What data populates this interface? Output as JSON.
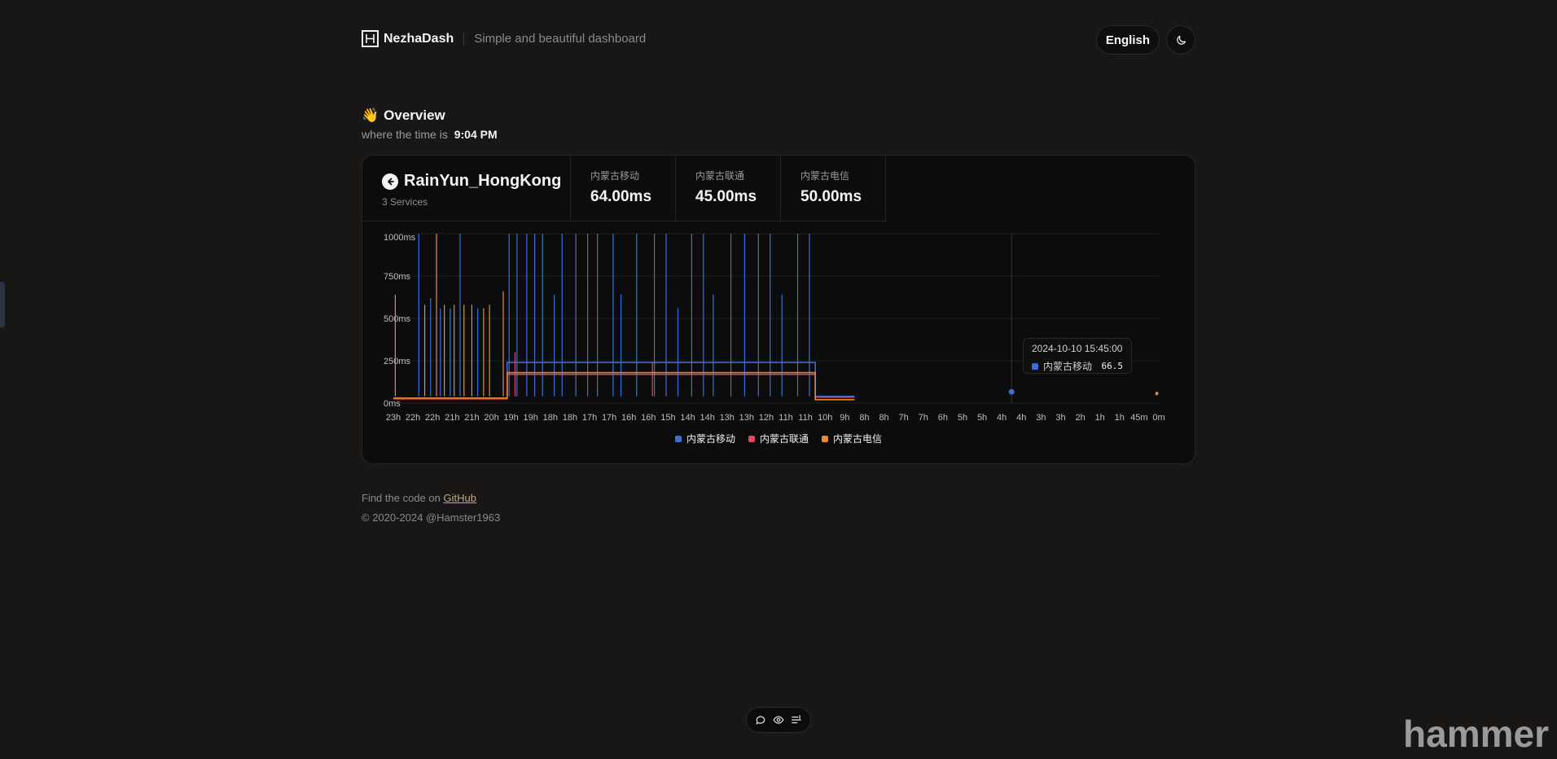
{
  "header": {
    "brand": "NezhaDash",
    "tagline": "Simple and beautiful dashboard",
    "language_label": "English",
    "theme_icon": "moon-icon"
  },
  "overview": {
    "emoji": "👋",
    "title": "Overview",
    "time_prefix": "where the time is",
    "time": "9:04 PM"
  },
  "server": {
    "name": "RainYun_HongKong",
    "services_count": "3 Services",
    "back_icon": "arrow-left-circle-icon"
  },
  "stats": [
    {
      "label": "内蒙古移动",
      "value": "64.00ms"
    },
    {
      "label": "内蒙古联通",
      "value": "45.00ms"
    },
    {
      "label": "内蒙古电信",
      "value": "50.00ms"
    }
  ],
  "colors": {
    "mobile": "#3b6fd6",
    "unicom": "#e0485c",
    "telecom": "#e98a34"
  },
  "tooltip": {
    "time": "2024-10-10 15:45:00",
    "series": "内蒙古移动",
    "value": "66.5"
  },
  "chart_data": {
    "type": "line",
    "y_ticks": [
      "0ms",
      "250ms",
      "500ms",
      "750ms",
      "1000ms"
    ],
    "ylim": [
      0,
      1000
    ],
    "x_ticks": [
      "23h",
      "22h",
      "22h",
      "21h",
      "21h",
      "20h",
      "19h",
      "19h",
      "18h",
      "18h",
      "17h",
      "17h",
      "16h",
      "16h",
      "15h",
      "14h",
      "14h",
      "13h",
      "13h",
      "12h",
      "11h",
      "11h",
      "10h",
      "9h",
      "8h",
      "8h",
      "7h",
      "7h",
      "6h",
      "5h",
      "5h",
      "4h",
      "4h",
      "3h",
      "3h",
      "2h",
      "1h",
      "1h",
      "45m",
      "0m"
    ],
    "legend_position": "bottom",
    "series": [
      {
        "name": "内蒙古移动",
        "color": "#3b6fd6",
        "baseline": [
          [
            0,
            30
          ],
          [
            5.8,
            30
          ],
          [
            5.8,
            240
          ],
          [
            21.5,
            240
          ],
          [
            21.5,
            40
          ],
          [
            23.5,
            40
          ]
        ],
        "spikes": [
          [
            1.3,
            1000
          ],
          [
            1.9,
            620
          ],
          [
            2.4,
            560
          ],
          [
            2.9,
            560
          ],
          [
            3.4,
            1000
          ],
          [
            4.3,
            560
          ],
          [
            5.9,
            1000
          ],
          [
            6.3,
            1000
          ],
          [
            6.8,
            1000
          ],
          [
            7.2,
            1000
          ],
          [
            7.6,
            1000
          ],
          [
            8.2,
            640
          ],
          [
            8.6,
            1000
          ],
          [
            9.3,
            1000
          ],
          [
            9.9,
            1000
          ],
          [
            10.4,
            1000
          ],
          [
            11.2,
            1000
          ],
          [
            11.6,
            640
          ],
          [
            12.4,
            1000
          ],
          [
            13.3,
            1000
          ],
          [
            13.9,
            1000
          ],
          [
            14.5,
            560
          ],
          [
            15.2,
            1000
          ],
          [
            15.8,
            1000
          ],
          [
            16.3,
            640
          ],
          [
            17.2,
            1000
          ],
          [
            17.9,
            1000
          ],
          [
            18.6,
            1000
          ],
          [
            19.2,
            1000
          ],
          [
            19.8,
            640
          ],
          [
            20.6,
            1000
          ],
          [
            21.2,
            1000
          ]
        ],
        "points": [
          [
            31.5,
            66.5
          ]
        ]
      },
      {
        "name": "内蒙古联通",
        "color": "#e0485c",
        "baseline": [
          [
            0,
            25
          ],
          [
            5.8,
            25
          ],
          [
            5.8,
            170
          ],
          [
            21.5,
            170
          ],
          [
            21.5,
            35
          ],
          [
            23.5,
            35
          ]
        ],
        "spikes": [
          [
            6.2,
            300
          ],
          [
            13.2,
            240
          ]
        ],
        "points": [
          [
            38.9,
            60
          ]
        ]
      },
      {
        "name": "内蒙古电信",
        "color": "#e98a34",
        "baseline": [
          [
            0,
            30
          ],
          [
            5.8,
            30
          ],
          [
            5.8,
            180
          ],
          [
            21.5,
            180
          ],
          [
            21.5,
            20
          ],
          [
            23.5,
            20
          ]
        ],
        "spikes": [
          [
            0.1,
            640
          ],
          [
            1.6,
            580
          ],
          [
            2.6,
            580
          ],
          [
            3.1,
            580
          ],
          [
            3.6,
            580
          ],
          [
            4.0,
            580
          ],
          [
            4.9,
            580
          ],
          [
            5.6,
            660
          ],
          [
            2.2,
            1000
          ],
          [
            4.6,
            560
          ]
        ],
        "points": [
          [
            38.9,
            55
          ]
        ]
      }
    ]
  },
  "legend": [
    "内蒙古移动",
    "内蒙古联通",
    "内蒙古电信"
  ],
  "footer": {
    "line1_prefix": "Find the code on",
    "line1_link": "GitHub",
    "line2": "© 2020-2024  @Hamster1963"
  },
  "dock": {
    "icons": [
      "message-icon",
      "eye-icon",
      "filter-list-icon"
    ]
  },
  "watermark": "hammer"
}
